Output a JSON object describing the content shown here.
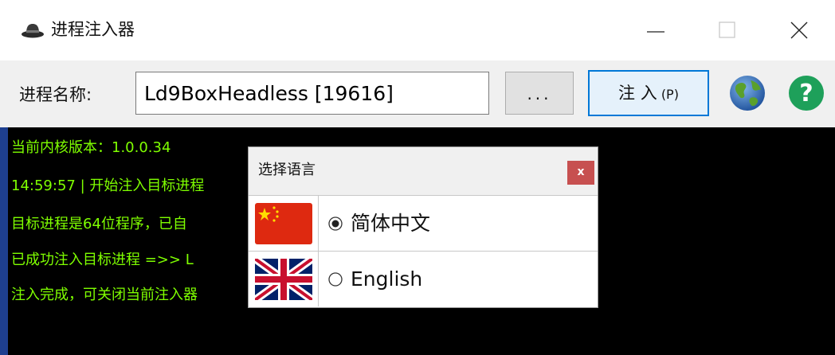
{
  "window": {
    "title": "进程注入器",
    "icons": {
      "app": "hat-icon",
      "minimize": "minimize-icon",
      "maximize": "maximize-icon",
      "close": "close-icon"
    }
  },
  "toolbar": {
    "process_label": "进程名称:",
    "process_value": "Ld9BoxHeadless [19616]",
    "browse_label": "...",
    "inject_label": "注 入",
    "inject_hotkey": "(P)",
    "language_icon": "globe-icon",
    "help_icon": "help-icon"
  },
  "console": {
    "lines": [
      "当前内核版本：1.0.0.34",
      "14:59:57 | 开始注入目标进程",
      "目标进程是64位程序，已自",
      "已成功注入目标进程 =>> L",
      "注入完成，可关闭当前注入器"
    ],
    "text_color": "#7fff00"
  },
  "language_dialog": {
    "title": "选择语言",
    "close_label": "x",
    "options": [
      {
        "flag": "china-flag-icon",
        "label": "简体中文",
        "selected": true
      },
      {
        "flag": "uk-flag-icon",
        "label": "English",
        "selected": false
      }
    ]
  }
}
